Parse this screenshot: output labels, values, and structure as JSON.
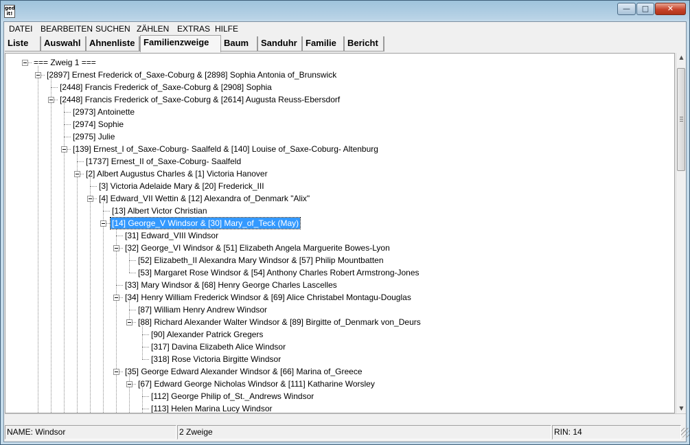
{
  "window": {
    "app_icon_text": "ged it!",
    "buttons": {
      "minimize": "—",
      "maximize": "□",
      "close": "✕"
    }
  },
  "menu": [
    "DATEI",
    "BEARBEITEN",
    "SUCHEN",
    "ZÄHLEN",
    "EXTRAS",
    "HILFE"
  ],
  "tabs": [
    "Liste",
    "Auswahl",
    "Ahnenliste",
    "Familienzweige",
    "Baum",
    "Sanduhr",
    "Familie",
    "Bericht"
  ],
  "active_tab": "Familienzweige",
  "tree": [
    {
      "level": 0,
      "label": "=== Zweig 1 ===",
      "expanded": true
    },
    {
      "level": 1,
      "label": "[2897] Ernest Frederick of_Saxe-Coburg  & [2898] Sophia Antonia of_Brunswick",
      "expanded": true
    },
    {
      "level": 2,
      "label": "[2448] Francis Frederick of_Saxe-Coburg  & [2908] Sophia"
    },
    {
      "level": 2,
      "label": "[2448] Francis Frederick of_Saxe-Coburg  & [2614] Augusta Reuss-Ebersdorf",
      "expanded": true
    },
    {
      "level": 3,
      "label": "[2973] Antoinette"
    },
    {
      "level": 3,
      "label": "[2974] Sophie"
    },
    {
      "level": 3,
      "label": "[2975] Julie"
    },
    {
      "level": 3,
      "label": "[139] Ernest_I of_Saxe-Coburg- Saalfeld  & [140] Louise of_Saxe-Coburg- Altenburg",
      "expanded": true
    },
    {
      "level": 4,
      "label": "[1737] Ernest_II of_Saxe-Coburg- Saalfeld"
    },
    {
      "level": 4,
      "label": "[2] Albert Augustus Charles  & [1] Victoria  Hanover",
      "expanded": true
    },
    {
      "level": 5,
      "label": "[3] Victoria Adelaide Mary  & [20] Frederick_III"
    },
    {
      "level": 5,
      "label": "[4] Edward_VII  Wettin & [12] Alexandra of_Denmark \"Alix\"",
      "expanded": true
    },
    {
      "level": 6,
      "label": "[13] Albert Victor Christian"
    },
    {
      "level": 6,
      "label": "[14] George_V  Windsor & [30] Mary_of_Teck (May)",
      "expanded": true,
      "selected": true
    },
    {
      "level": 7,
      "label": "[31] Edward_VIII  Windsor"
    },
    {
      "level": 7,
      "label": "[32] George_VI  Windsor & [51] Elizabeth Angela Marguerite Bowes-Lyon",
      "expanded": true
    },
    {
      "level": 8,
      "label": "[52] Elizabeth_II Alexandra Mary Windsor & [57] Philip  Mountbatten"
    },
    {
      "level": 8,
      "label": "[53] Margaret Rose  Windsor & [54] Anthony Charles Robert Armstrong-Jones"
    },
    {
      "level": 7,
      "label": "[33] Mary  Windsor & [68] Henry George Charles Lascelles"
    },
    {
      "level": 7,
      "label": "[34] Henry William Frederick Windsor & [69] Alice Christabel  Montagu-Douglas",
      "expanded": true
    },
    {
      "level": 8,
      "label": "[87] William Henry Andrew Windsor"
    },
    {
      "level": 8,
      "label": "[88] Richard Alexander Walter Windsor & [89] Birgitte of_Denmark  von_Deurs",
      "expanded": true
    },
    {
      "level": 9,
      "label": "[90] Alexander Patrick Gregers"
    },
    {
      "level": 9,
      "label": "[317] Davina Elizabeth Alice Windsor"
    },
    {
      "level": 9,
      "label": "[318] Rose Victoria Birgitte Windsor"
    },
    {
      "level": 7,
      "label": "[35] George Edward Alexander Windsor & [66] Marina of_Greece",
      "expanded": true
    },
    {
      "level": 8,
      "label": "[67] Edward George Nicholas Windsor & [111] Katharine  Worsley",
      "expanded": true
    },
    {
      "level": 9,
      "label": "[112] George Philip of_St._Andrews Windsor"
    },
    {
      "level": 9,
      "label": "[113] Helen Marina Lucy Windsor"
    }
  ],
  "scrollbar": {
    "up": "▲",
    "down": "▼"
  },
  "status": {
    "name": "NAME: Windsor",
    "zweige": "2 Zweige",
    "rin": "RIN: 14"
  }
}
